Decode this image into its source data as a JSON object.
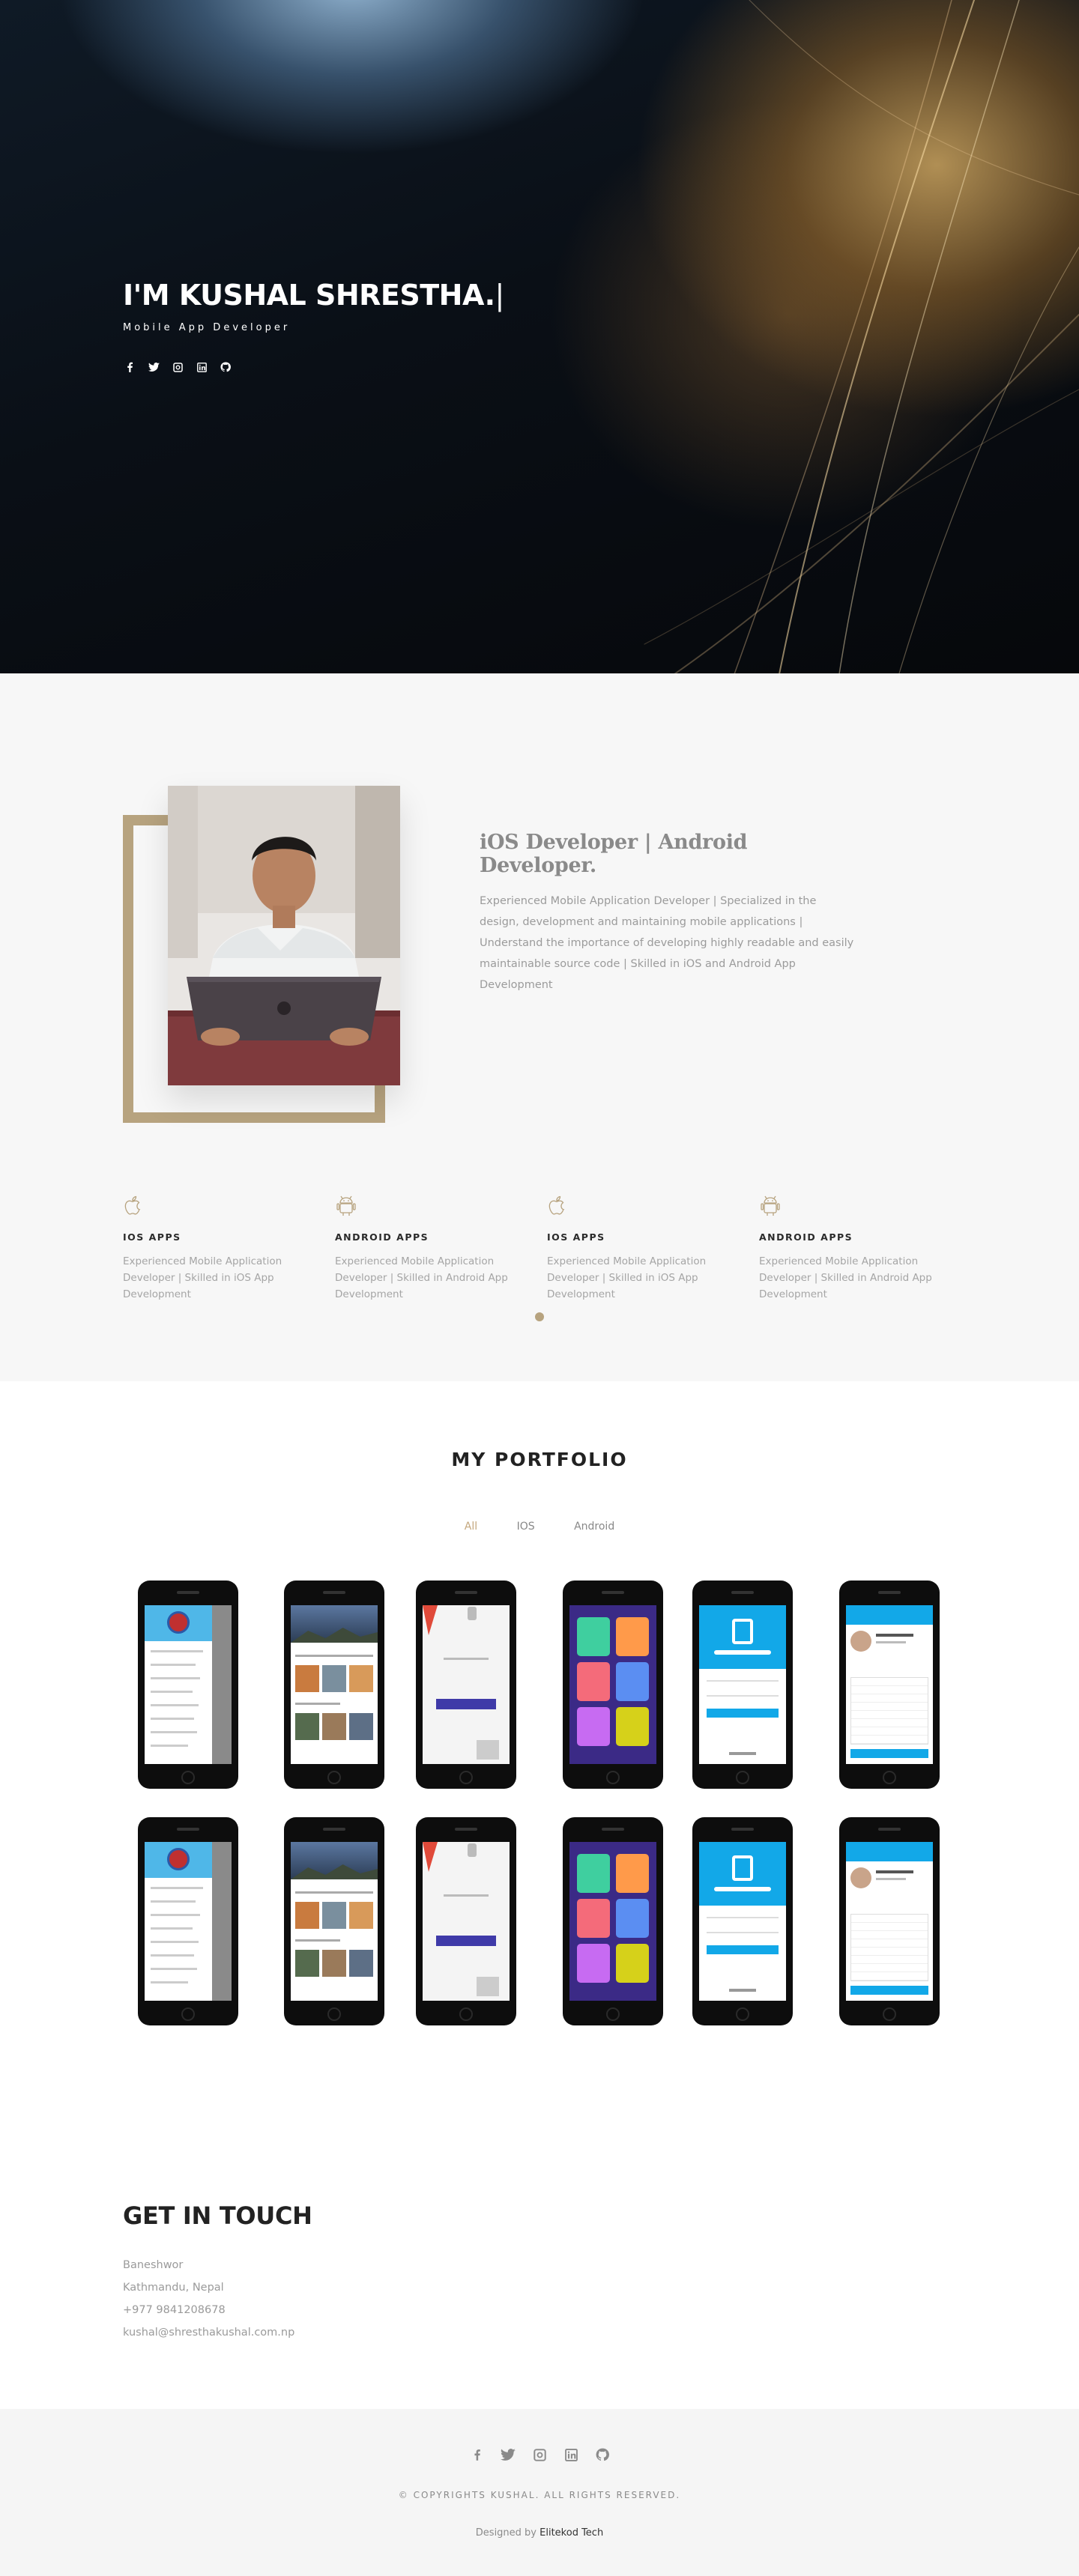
{
  "hero": {
    "title": "I'M KUSHAL SHRESTHA.",
    "cursor": "|",
    "subtitle": "Mobile App Developer",
    "social_icons": [
      "facebook-icon",
      "twitter-icon",
      "instagram-icon",
      "linkedin-icon",
      "github-icon"
    ]
  },
  "about": {
    "heading": "iOS Developer | Android Developer.",
    "description": "Experienced Mobile Application Developer | Specialized in the design, development and maintaining mobile applications | Understand the importance of developing highly readable and easily maintainable source code | Skilled in iOS and Android App Development",
    "services": [
      {
        "icon": "apple-icon",
        "title": "IOS APPS",
        "desc": "Experienced Mobile Application Developer | Skilled in iOS App Development"
      },
      {
        "icon": "android-icon",
        "title": "ANDROID APPS",
        "desc": "Experienced Mobile Application Developer | Skilled in Android App Development"
      },
      {
        "icon": "apple-icon",
        "title": "IOS APPS",
        "desc": "Experienced Mobile Application Developer | Skilled in iOS App Development"
      },
      {
        "icon": "android-icon",
        "title": "ANDROID APPS",
        "desc": "Experienced Mobile Application Developer | Skilled in Android App Development"
      }
    ]
  },
  "portfolio": {
    "title": "MY PORTFOLIO",
    "filters": [
      {
        "label": "All",
        "active": true
      },
      {
        "label": "IOS",
        "active": false
      },
      {
        "label": "Android",
        "active": false
      }
    ]
  },
  "contact": {
    "title": "GET IN TOUCH",
    "address_line1": "Baneshwor",
    "address_line2": "Kathmandu, Nepal",
    "phone": "+977 9841208678",
    "email": "kushal@shresthakushal.com.np"
  },
  "footer": {
    "copyright": "© COPYRIGHTS KUSHAL. ALL RIGHTS RESERVED.",
    "designed_by_prefix": "Designed by",
    "designed_by_brand": "Elitekod Tech",
    "social_icons": [
      "facebook-icon",
      "twitter-icon",
      "instagram-icon",
      "linkedin-icon",
      "github-icon"
    ]
  },
  "colors": {
    "accent": "#b7a37f",
    "filter_active": "#c4a77d",
    "hero_bg": "#0a0f16",
    "about_bg": "#f7f7f7",
    "footer_bg": "#f5f5f5"
  }
}
